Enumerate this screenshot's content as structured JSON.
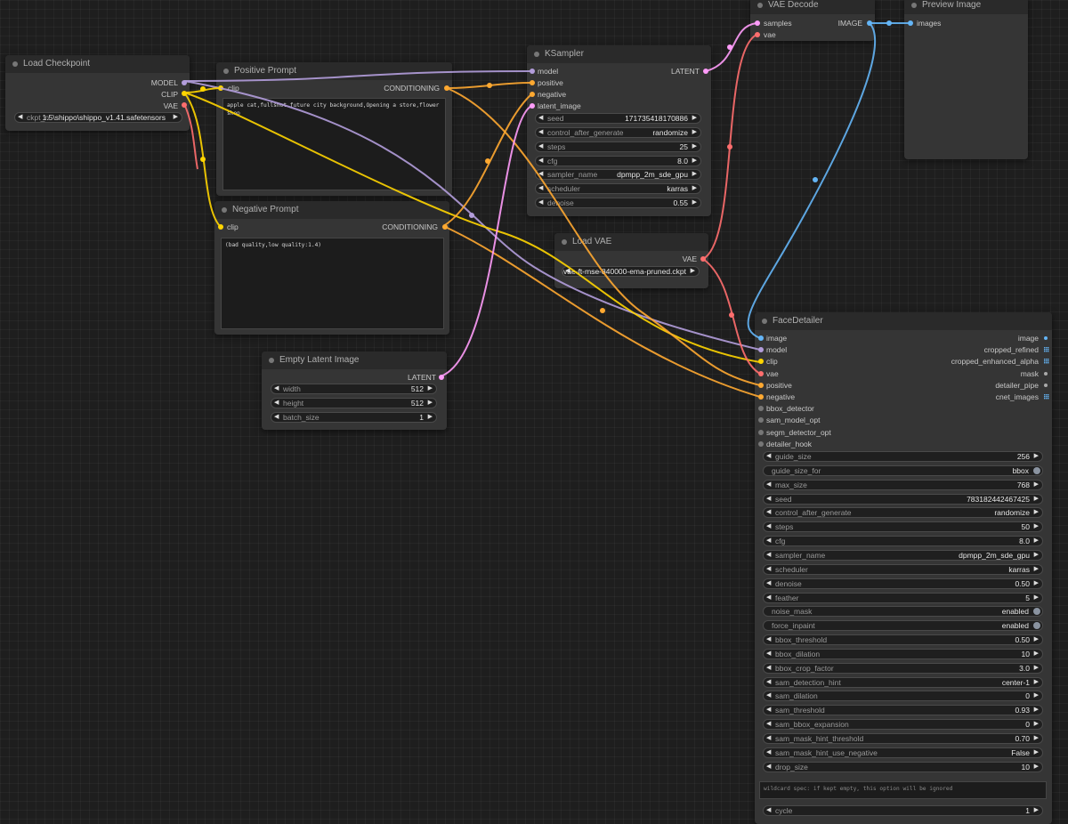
{
  "colors": {
    "model": "#b39ddb",
    "clip": "#ffd500",
    "vae": "#ff6e6e",
    "conditioning": "#ffa931",
    "latent": "#ff9cf9",
    "image": "#64b5f6",
    "inactive": "#777777"
  },
  "nodes": {
    "load_checkpoint": {
      "title": "Load Checkpoint",
      "outputs": [
        "MODEL",
        "CLIP",
        "VAE"
      ],
      "ckpt_name": {
        "name": "ckpt_n",
        "value": "1.5\\shippo\\shippo_v1.41.safetensors"
      }
    },
    "positive_prompt": {
      "title": "Positive Prompt",
      "input": "clip",
      "output": "CONDITIONING",
      "text": "apple cat,fullshot future city background,Opening a store,flower shop"
    },
    "negative_prompt": {
      "title": "Negative Prompt",
      "input": "clip",
      "output": "CONDITIONING",
      "text": "(bad quality,low quality:1.4)"
    },
    "empty_latent": {
      "title": "Empty Latent Image",
      "output": "LATENT",
      "widgets": [
        {
          "name": "width",
          "value": "512"
        },
        {
          "name": "height",
          "value": "512"
        },
        {
          "name": "batch_size",
          "value": "1"
        }
      ]
    },
    "ksampler": {
      "title": "KSampler",
      "inputs": [
        "model",
        "positive",
        "negative",
        "latent_image"
      ],
      "output": "LATENT",
      "widgets": [
        {
          "name": "seed",
          "value": "171735418170886"
        },
        {
          "name": "control_after_generate",
          "value": "randomize"
        },
        {
          "name": "steps",
          "value": "25"
        },
        {
          "name": "cfg",
          "value": "8.0"
        },
        {
          "name": "sampler_name",
          "value": "dpmpp_2m_sde_gpu"
        },
        {
          "name": "scheduler",
          "value": "karras"
        },
        {
          "name": "denoise",
          "value": "0.55"
        }
      ]
    },
    "load_vae": {
      "title": "Load VAE",
      "output": "VAE",
      "vae_name": {
        "name": "vae_name",
        "value": "1.5\\vae-ft-mse-840000-ema-pruned.ckpt"
      }
    },
    "vae_decode": {
      "title": "VAE Decode",
      "inputs": [
        "samples",
        "vae"
      ],
      "output": "IMAGE"
    },
    "preview_image": {
      "title": "Preview Image",
      "input": "images"
    },
    "face_detailer": {
      "title": "FaceDetailer",
      "inputs": [
        "image",
        "model",
        "clip",
        "vae",
        "positive",
        "negative",
        "bbox_detector",
        "sam_model_opt",
        "segm_detector_opt",
        "detailer_hook"
      ],
      "outputs": [
        "image",
        "cropped_refined",
        "cropped_enhanced_alpha",
        "mask",
        "detailer_pipe",
        "cnet_images"
      ],
      "widgets": [
        {
          "name": "guide_size",
          "value": "256",
          "kind": "num"
        },
        {
          "name": "guide_size_for",
          "value": "bbox",
          "kind": "toggle"
        },
        {
          "name": "max_size",
          "value": "768",
          "kind": "num"
        },
        {
          "name": "seed",
          "value": "783182442467425",
          "kind": "num"
        },
        {
          "name": "control_after_generate",
          "value": "randomize",
          "kind": "num"
        },
        {
          "name": "steps",
          "value": "50",
          "kind": "num"
        },
        {
          "name": "cfg",
          "value": "8.0",
          "kind": "num"
        },
        {
          "name": "sampler_name",
          "value": "dpmpp_2m_sde_gpu",
          "kind": "num"
        },
        {
          "name": "scheduler",
          "value": "karras",
          "kind": "num"
        },
        {
          "name": "denoise",
          "value": "0.50",
          "kind": "num"
        },
        {
          "name": "feather",
          "value": "5",
          "kind": "num"
        },
        {
          "name": "noise_mask",
          "value": "enabled",
          "kind": "toggle"
        },
        {
          "name": "force_inpaint",
          "value": "enabled",
          "kind": "toggle"
        },
        {
          "name": "bbox_threshold",
          "value": "0.50",
          "kind": "num"
        },
        {
          "name": "bbox_dilation",
          "value": "10",
          "kind": "num"
        },
        {
          "name": "bbox_crop_factor",
          "value": "3.0",
          "kind": "num"
        },
        {
          "name": "sam_detection_hint",
          "value": "center-1",
          "kind": "num"
        },
        {
          "name": "sam_dilation",
          "value": "0",
          "kind": "num"
        },
        {
          "name": "sam_threshold",
          "value": "0.93",
          "kind": "num"
        },
        {
          "name": "sam_bbox_expansion",
          "value": "0",
          "kind": "num"
        },
        {
          "name": "sam_mask_hint_threshold",
          "value": "0.70",
          "kind": "num"
        },
        {
          "name": "sam_mask_hint_use_negative",
          "value": "False",
          "kind": "num"
        },
        {
          "name": "drop_size",
          "value": "10",
          "kind": "num"
        }
      ],
      "wildcard_text": "wildcard spec: if kept empty, this option will be ignored",
      "cycle": {
        "name": "cycle",
        "value": "1"
      }
    }
  }
}
